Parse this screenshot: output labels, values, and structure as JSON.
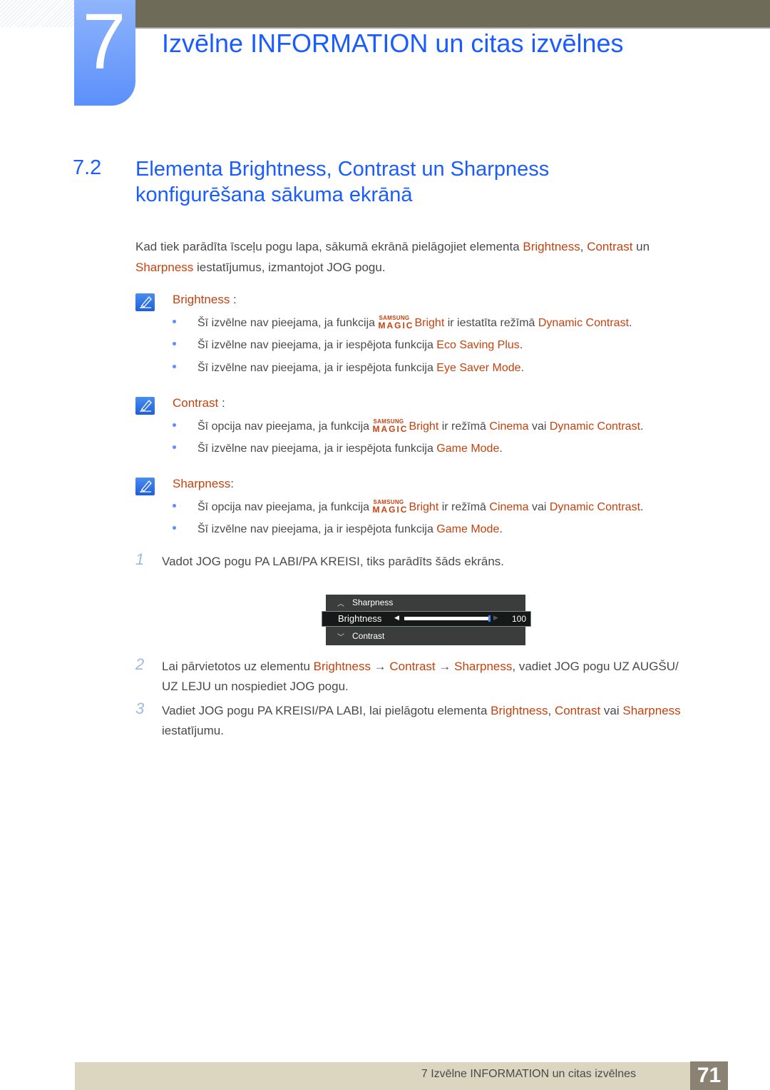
{
  "header": {
    "chapter_number": "7",
    "chapter_title": "Izvēlne INFORMATION un citas izvēlnes"
  },
  "section": {
    "number": "7.2",
    "title_line1": "Elementa Brightness, Contrast un Sharpness",
    "title_line2": "konfigurēšana sākuma ekrānā"
  },
  "intro": {
    "p1": "Kad tiek parādīta īsceļu pogu lapa, sākumā ekrānā pielāgojiet elementa ",
    "hl1": "Brightness",
    "p2": ", ",
    "hl2": "Contrast",
    "p3": " un ",
    "hl3": "Sharpness",
    "p4": " iestatījumus, izmantojot JOG pogu."
  },
  "magic_logo": {
    "top": "SAMSUNG",
    "bottom": "MAGIC",
    "suffix": "Bright"
  },
  "notes": [
    {
      "label": "Brightness",
      "colon": " :",
      "bullets": [
        {
          "pre": "Šī izvēlne nav pieejama, ja funkcija ",
          "magic": true,
          "mid": " ir iestatīta režīmā ",
          "hl1": "Dynamic Contrast",
          "mid2": "",
          "hl2": "",
          "post": "."
        },
        {
          "pre": "Šī izvēlne nav pieejama, ja ir iespējota funkcija ",
          "magic": false,
          "mid": "",
          "hl1": "Eco Saving Plus",
          "mid2": "",
          "hl2": "",
          "post": "."
        },
        {
          "pre": "Šī izvēlne nav pieejama, ja ir iespējota funkcija ",
          "magic": false,
          "mid": "",
          "hl1": "Eye Saver Mode",
          "mid2": "",
          "hl2": "",
          "post": "."
        }
      ]
    },
    {
      "label": "Contrast",
      "colon": " :",
      "bullets": [
        {
          "pre": "Šī opcija nav pieejama, ja funkcija ",
          "magic": true,
          "mid": " ir režīmā ",
          "hl1": "Cinema",
          "mid2": " vai ",
          "hl2": "Dynamic Contrast",
          "post": "."
        },
        {
          "pre": "Šī izvēlne nav pieejama, ja ir iespējota funkcija ",
          "magic": false,
          "mid": "",
          "hl1": "Game Mode",
          "mid2": "",
          "hl2": "",
          "post": "."
        }
      ]
    },
    {
      "label": "Sharpness",
      "colon": ":",
      "bullets": [
        {
          "pre": "Šī opcija nav pieejama, ja funkcija ",
          "magic": true,
          "mid": " ir režīmā ",
          "hl1": "Cinema",
          "mid2": " vai ",
          "hl2": "Dynamic Contrast",
          "post": "."
        },
        {
          "pre": "Šī izvēlne nav pieejama, ja ir iespējota funkcija ",
          "magic": false,
          "mid": "",
          "hl1": "Game Mode",
          "mid2": "",
          "hl2": "",
          "post": "."
        }
      ]
    }
  ],
  "steps": [
    {
      "num": "1",
      "line1": "Vadot JOG pogu PA LABI/PA KREISI, tiks parādīts šāds ekrāns."
    },
    {
      "num": "2",
      "pre": "Lai pārvietotos uz elementu ",
      "hl1": "Brightness",
      "arrow1": " → ",
      "hl2": "Contrast",
      "arrow2": " → ",
      "hl3": "Sharpness",
      "post": ", vadiet JOG pogu UZ AUGŠU/",
      "line2": "UZ LEJU un nospiediet JOG pogu."
    },
    {
      "num": "3",
      "pre": "Vadiet JOG pogu PA KREISI/PA LABI, lai pielāgotu elementa ",
      "hl1": "Brightness",
      "sep1": ", ",
      "hl2": "Contrast",
      "sep2": " vai ",
      "hl3": "Sharpness",
      "line2": "iestatījumu."
    }
  ],
  "osd": {
    "up_item": "Sharpness",
    "selected_item": "Brightness",
    "down_item": "Contrast",
    "value": "100",
    "value_fraction": 1.0
  },
  "footer": {
    "text": "7 Izvēlne INFORMATION un citas izvēlnes",
    "page": "71"
  },
  "colors": {
    "heading_blue": "#1a5cff",
    "highlight_orange": "#c5420e",
    "topbar": "#6e6b58",
    "footer_bg": "#dcd5c0",
    "page_box": "#8c8274"
  }
}
